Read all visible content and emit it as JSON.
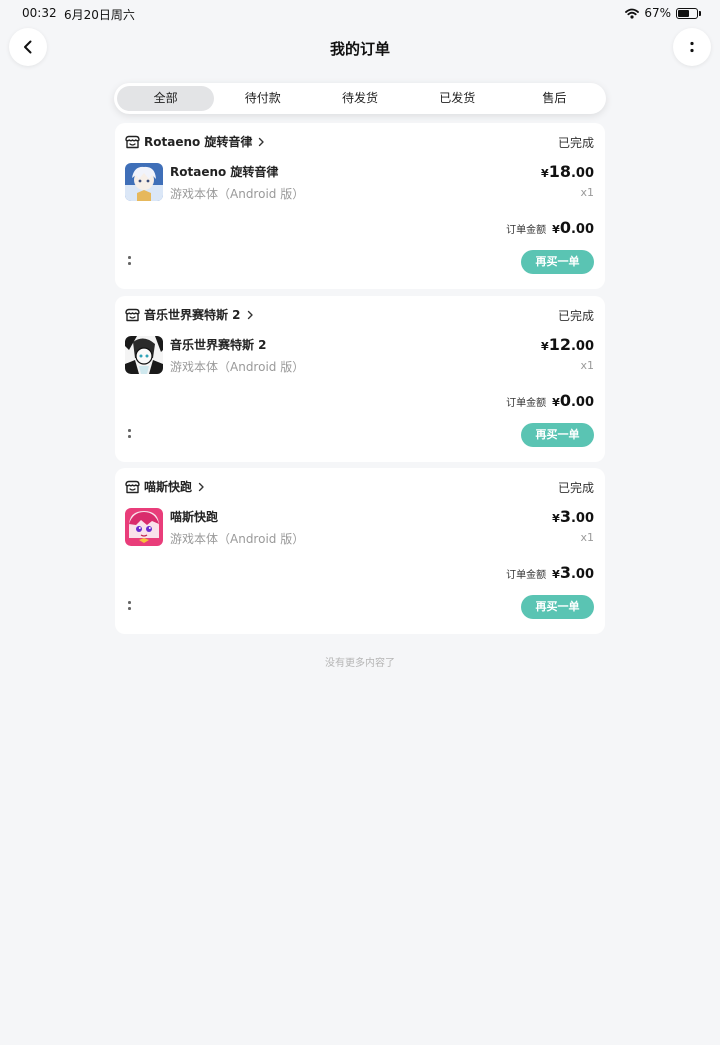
{
  "status_bar": {
    "time": "00:32",
    "date": "6月20日周六",
    "battery": "67%",
    "battery_level": 0.67
  },
  "header": {
    "title": "我的订单",
    "back_icon": "chevron-left-icon",
    "more_icon": "more-vertical-icon"
  },
  "tabs": [
    {
      "label": "全部",
      "active": true
    },
    {
      "label": "待付款",
      "active": false
    },
    {
      "label": "待发货",
      "active": false
    },
    {
      "label": "已发货",
      "active": false
    },
    {
      "label": "售后",
      "active": false
    }
  ],
  "orders": [
    {
      "store": "Rotaeno 旋转音律",
      "status": "已完成",
      "game_name": "Rotaeno 旋转音律",
      "desc": "游戏本体（Android 版）",
      "price_currency": "¥",
      "price_int": "18",
      "price_dec": ".00",
      "qty": "x1",
      "total_label": "订单金额",
      "total_currency": "¥",
      "total_int": "0",
      "total_dec": ".00",
      "rebuy": "再买一单"
    },
    {
      "store": "音乐世界赛特斯 2",
      "status": "已完成",
      "game_name": "音乐世界赛特斯 2",
      "desc": "游戏本体（Android 版）",
      "price_currency": "¥",
      "price_int": "12",
      "price_dec": ".00",
      "qty": "x1",
      "total_label": "订单金额",
      "total_currency": "¥",
      "total_int": "0",
      "total_dec": ".00",
      "rebuy": "再买一单"
    },
    {
      "store": "喵斯快跑",
      "status": "已完成",
      "game_name": "喵斯快跑",
      "desc": "游戏本体（Android 版）",
      "price_currency": "¥",
      "price_int": "3",
      "price_dec": ".00",
      "qty": "x1",
      "total_label": "订单金额",
      "total_currency": "¥",
      "total_int": "3",
      "total_dec": ".00",
      "rebuy": "再买一单"
    }
  ],
  "footer": "没有更多内容了",
  "colors": {
    "accent": "#5ac4b3",
    "background": "#f5f6f8"
  }
}
